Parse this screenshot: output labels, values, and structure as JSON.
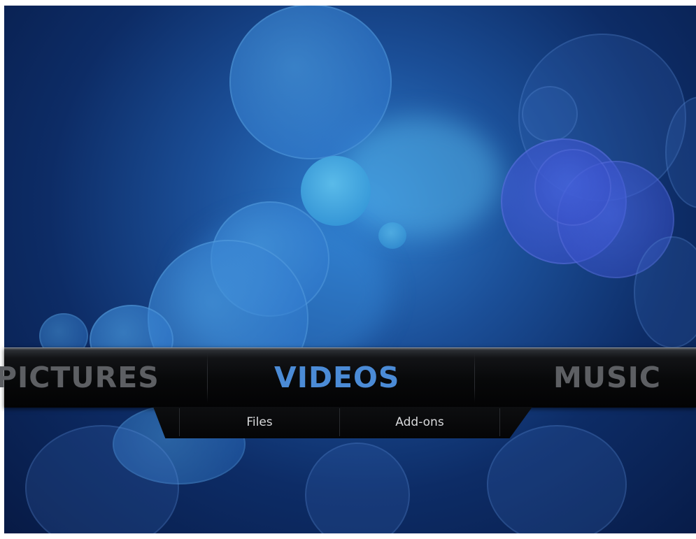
{
  "main_menu": {
    "items": [
      {
        "label": "PICTURES"
      },
      {
        "label": "VIDEOS",
        "selected": true
      },
      {
        "label": "MUSIC"
      }
    ]
  },
  "submenu": {
    "items": [
      {
        "label": "Files"
      },
      {
        "label": "Add-ons"
      }
    ]
  },
  "colors": {
    "active_item": "#4b8bd6",
    "inactive_item": "#5d5f63",
    "submenu_text": "#d9dadc",
    "background_deep": "#071a45"
  }
}
